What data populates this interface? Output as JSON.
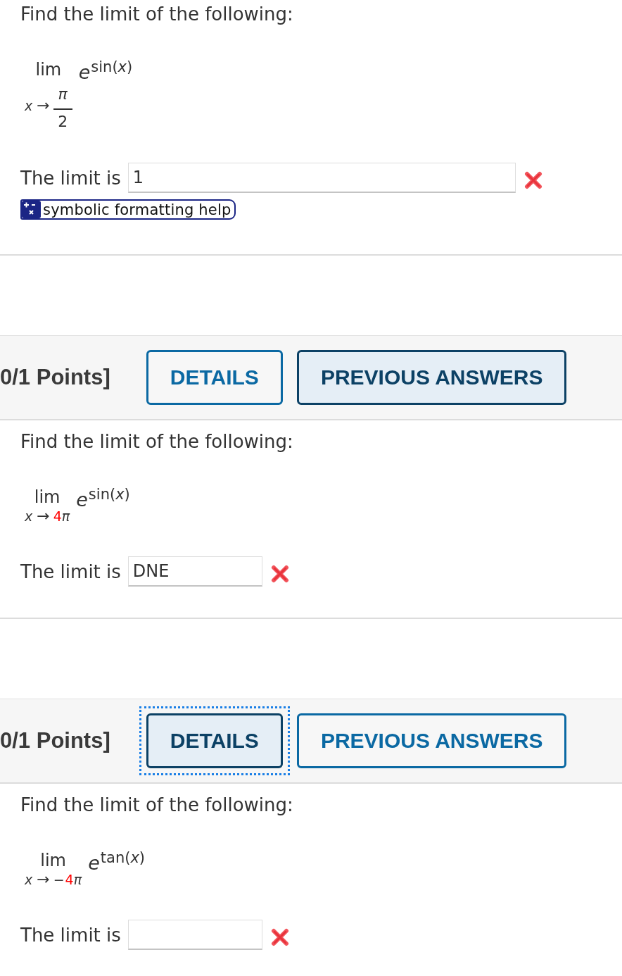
{
  "questions": [
    {
      "prompt": "Find the limit of the following:",
      "limit": {
        "operator": "lim",
        "variable": "x",
        "arrow": "→",
        "target": {
          "kind": "fraction",
          "numerator": "π",
          "denominator": "2"
        },
        "base": "e",
        "exponent": "sin(*x*)"
      },
      "answer": {
        "kind": "symbolic",
        "label": "The limit is",
        "value": "1",
        "correct": false,
        "help_button": "symbolic formatting help"
      }
    },
    {
      "header": {
        "points": "0/1 Points]",
        "buttons": [
          {
            "label": "DETAILS",
            "selected": false,
            "focused": false
          },
          {
            "label": "PREVIOUS ANSWERS",
            "selected": true,
            "focused": false
          }
        ]
      },
      "prompt": "Find the limit of the following:",
      "limit": {
        "operator": "lim",
        "variable": "x",
        "arrow": "→",
        "target": {
          "kind": "inline",
          "parts": [
            {
              "kind": "number",
              "text": "4",
              "highlighted": true
            },
            {
              "kind": "symbol",
              "text": "π",
              "highlighted": false
            }
          ]
        },
        "base": "e",
        "exponent": "sin(*x*)"
      },
      "answer": {
        "kind": "plain",
        "label": "The limit is",
        "value": "DNE",
        "correct": false
      }
    },
    {
      "header": {
        "points": "0/1 Points]",
        "buttons": [
          {
            "label": "DETAILS",
            "selected": true,
            "focused": true
          },
          {
            "label": "PREVIOUS ANSWERS",
            "selected": false,
            "focused": false
          }
        ]
      },
      "prompt": "Find the limit of the following:",
      "limit": {
        "operator": "lim",
        "variable": "x",
        "arrow": "→",
        "target": {
          "kind": "inline",
          "parts": [
            {
              "kind": "operator",
              "text": "−",
              "highlighted": false
            },
            {
              "kind": "number",
              "text": "4",
              "highlighted": true
            },
            {
              "kind": "symbol",
              "text": "π",
              "highlighted": false
            }
          ]
        },
        "base": "e",
        "exponent": "tan(*x*)"
      },
      "answer": {
        "kind": "plain",
        "label": "The limit is",
        "correct": false
      }
    }
  ]
}
